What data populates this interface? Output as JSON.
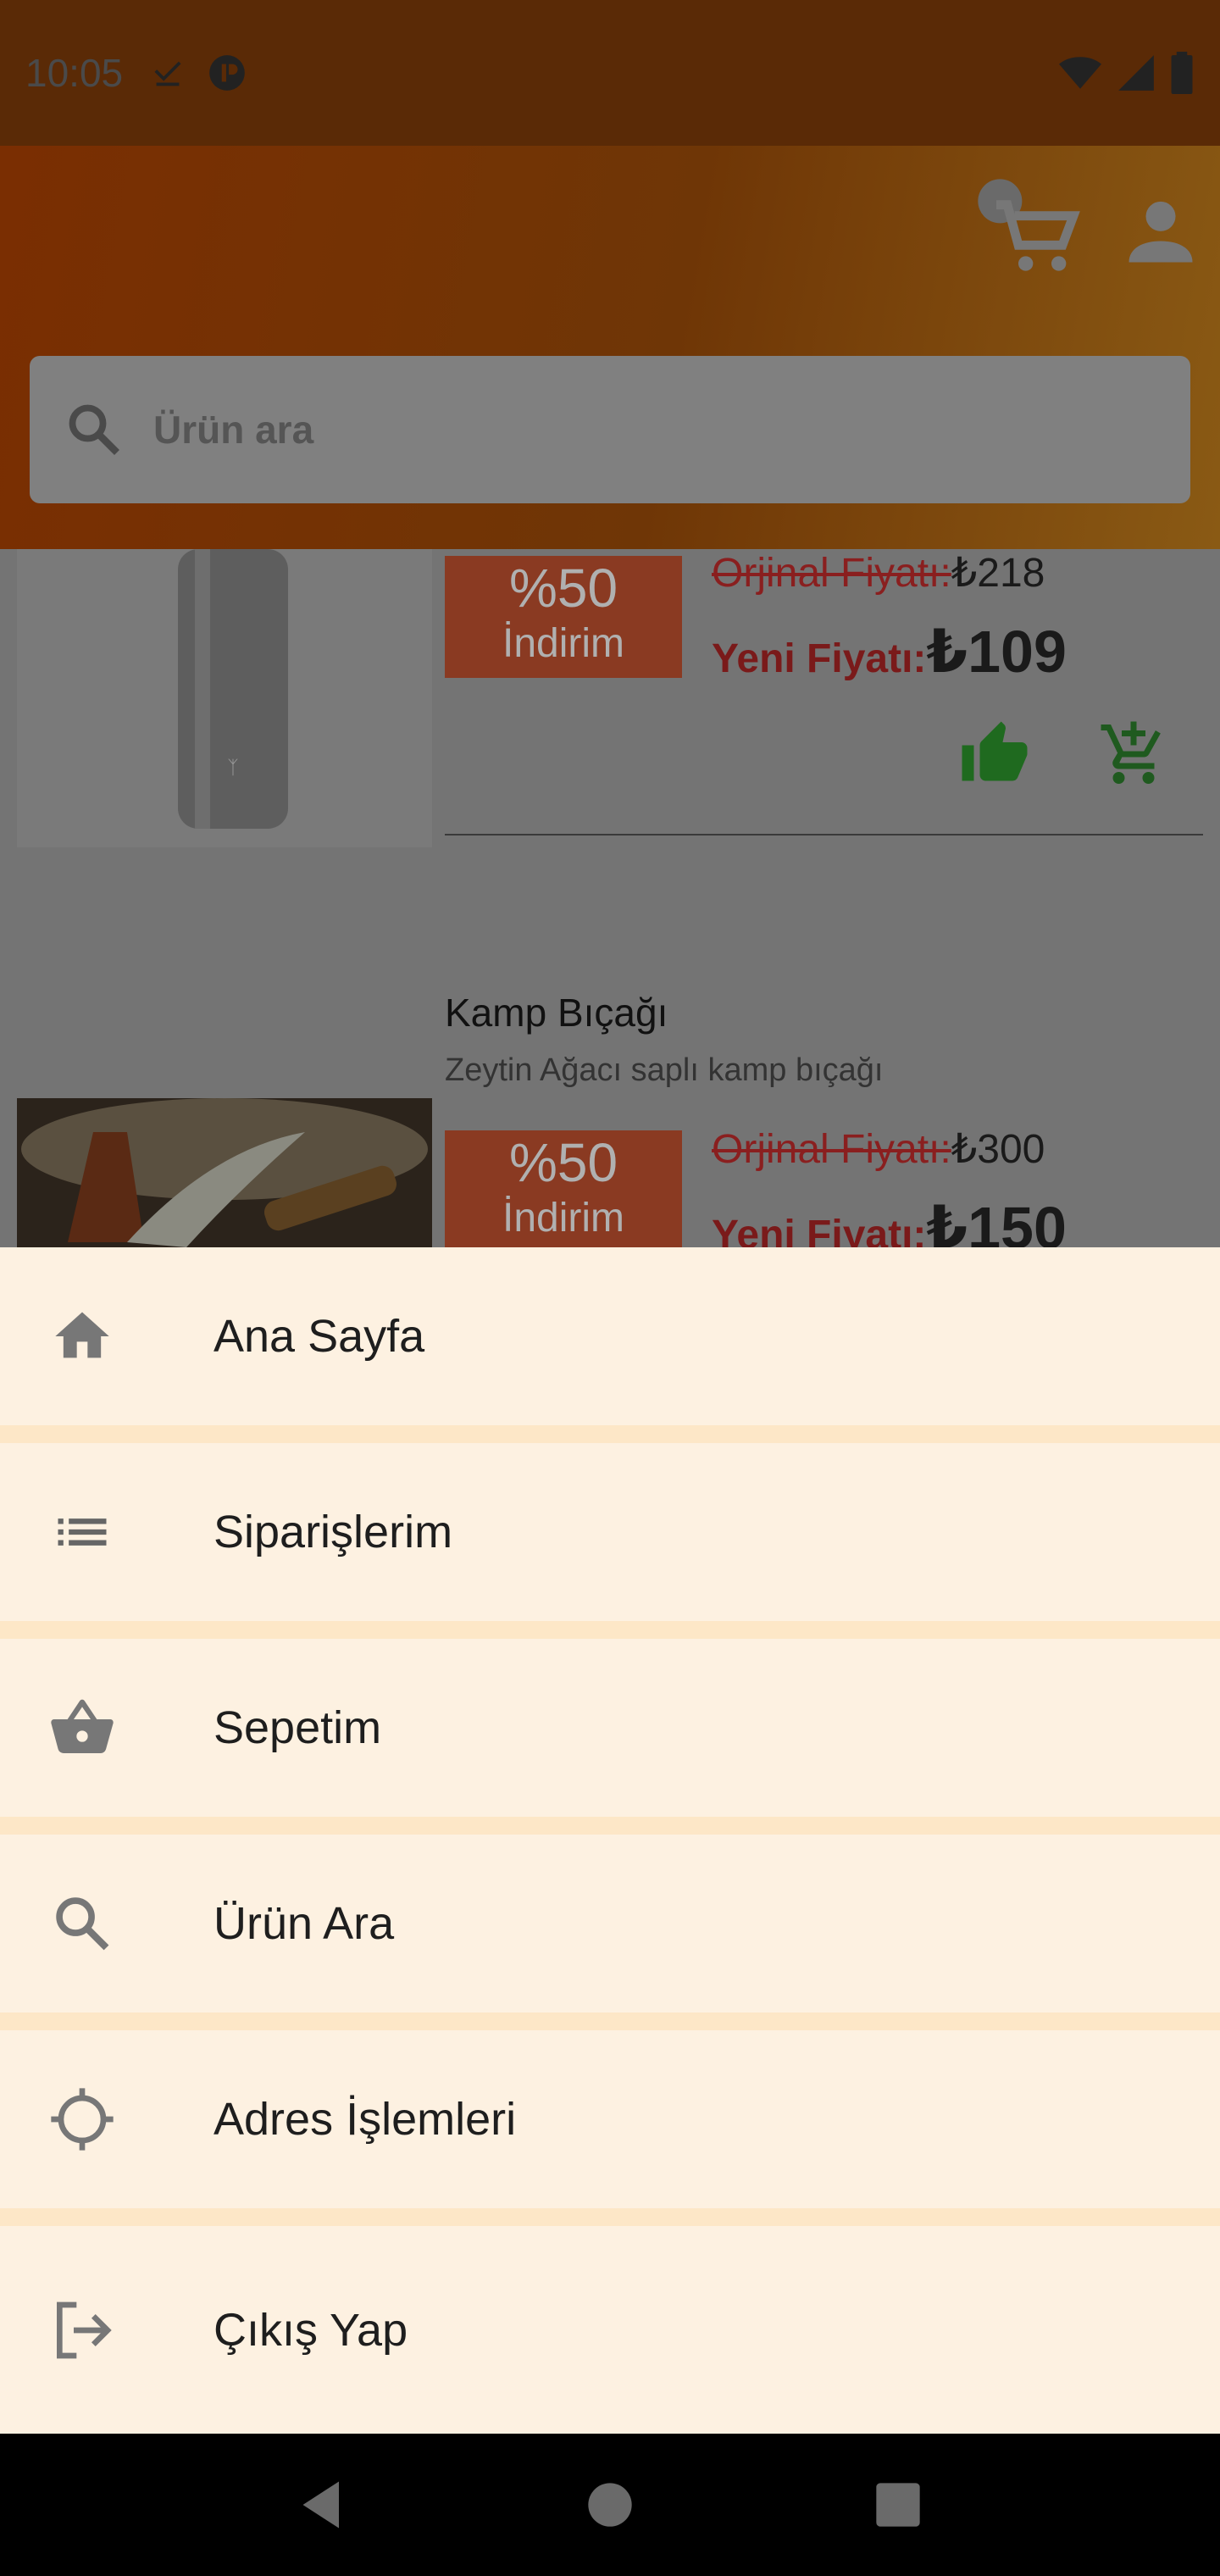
{
  "status_bar": {
    "time": "10:05"
  },
  "search": {
    "placeholder": "Ürün ara"
  },
  "products": [
    {
      "discount_pct": "%50",
      "discount_label": "İndirim",
      "old_price_label": "Orjinal Fiyatı:",
      "old_price_value": "₺218",
      "new_price_label": "Yeni Fiyatı:",
      "new_price_value": "₺109"
    },
    {
      "title": "Kamp Bıçağı",
      "description": "Zeytin Ağacı saplı kamp bıçağı",
      "discount_pct": "%50",
      "discount_label": "İndirim",
      "old_price_label": "Orjinal Fiyatı:",
      "old_price_value": "₺300",
      "new_price_label": "Yeni Fiyatı:",
      "new_price_value": "₺150"
    }
  ],
  "menu": {
    "items": [
      {
        "label": "Ana Sayfa",
        "icon": "home-icon"
      },
      {
        "label": "Siparişlerim",
        "icon": "list-icon"
      },
      {
        "label": "Sepetim",
        "icon": "basket-icon"
      },
      {
        "label": "Ürün Ara",
        "icon": "search-icon"
      },
      {
        "label": "Adres İşlemleri",
        "icon": "location-icon"
      },
      {
        "label": "Çıkış Yap",
        "icon": "logout-icon"
      }
    ]
  },
  "colors": {
    "sheet_background": "#fde7c7",
    "menu_item_background": "#fdf1e1",
    "header_start": "#7a2e02",
    "header_end": "#8a5a14"
  }
}
